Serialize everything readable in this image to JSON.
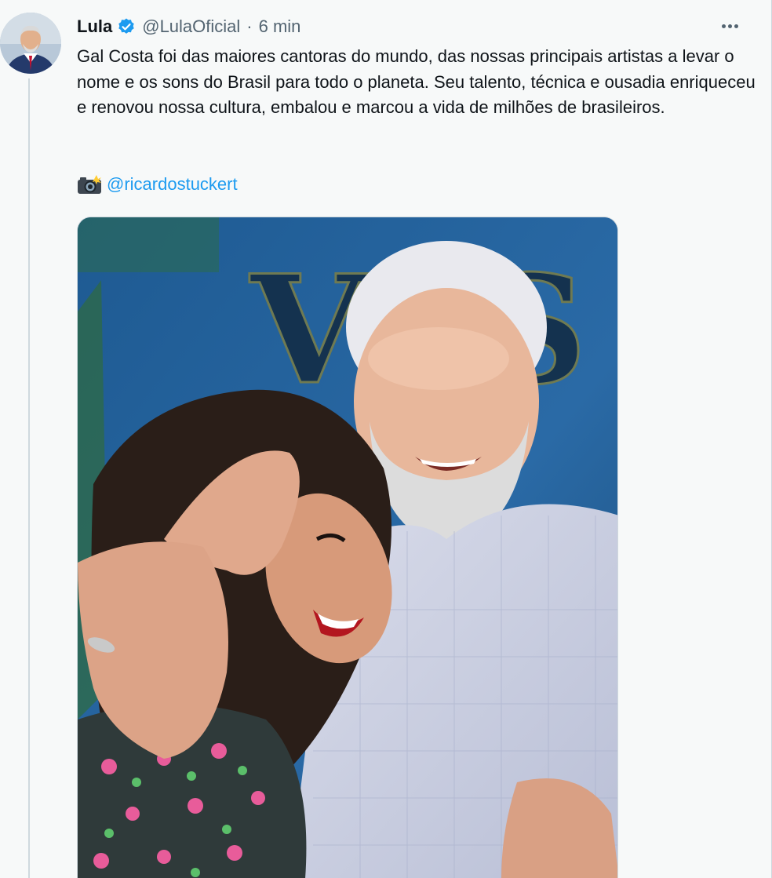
{
  "tweet": {
    "author_name": "Lula",
    "handle": "@LulaOficial",
    "separator": "·",
    "time": "6 min",
    "text": "Gal Costa foi das maiores cantoras do mundo, das nossas principais artistas a levar o nome e os sons do Brasil para todo o planeta. Seu talento, técnica e ousadia enriqueceu e renovou nossa cultura, embalou e marcou a vida de milhões de brasileiros.",
    "credit_mention": "@ricardostuckert",
    "media_background_letters": "VES"
  },
  "icons": {
    "verified": "verified-badge-icon",
    "more": "more-options-icon",
    "camera": "camera-flash-icon"
  },
  "colors": {
    "background": "#f7f9f9",
    "text": "#0f1419",
    "secondary_text": "#536471",
    "link": "#1d9bf0",
    "verified": "#1d9bf0"
  }
}
